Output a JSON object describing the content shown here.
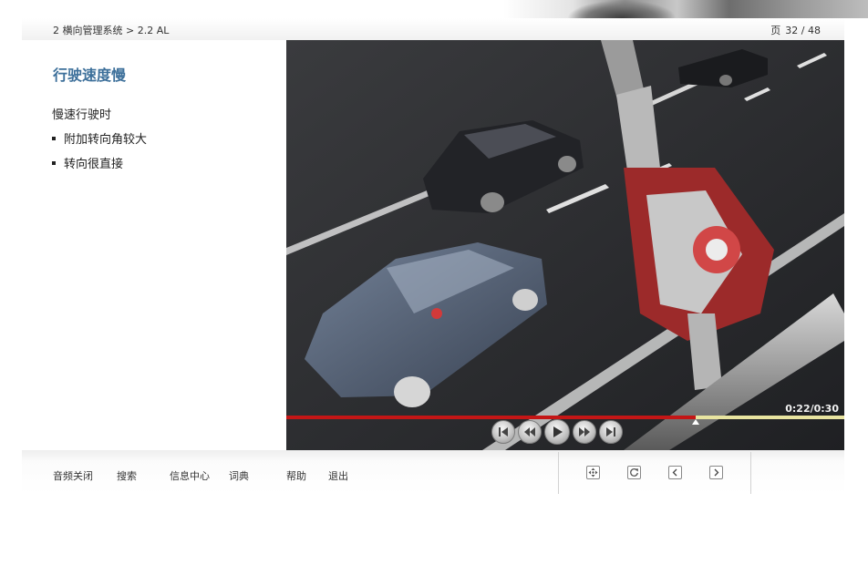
{
  "header": {
    "breadcrumb": "2 横向管理系统 > 2.2 AL",
    "page_label": "页",
    "page_counter": "32 / 48"
  },
  "content": {
    "title": "行驶速度慢",
    "subhead": "慢速行驶时",
    "bullets": [
      "附加转向角较大",
      "转向很直接"
    ]
  },
  "video": {
    "time": "0:22/0:30",
    "progress_fraction": 0.733,
    "colors": {
      "played": "#c41616",
      "remaining": "#e8e4a0"
    },
    "controls": [
      {
        "name": "skip-start-icon"
      },
      {
        "name": "rewind-icon"
      },
      {
        "name": "play-icon"
      },
      {
        "name": "fast-forward-icon"
      },
      {
        "name": "skip-end-icon"
      }
    ]
  },
  "toolbar": {
    "links": [
      "音频关闭",
      "搜索",
      "信息中心",
      "词典",
      "帮助",
      "退出"
    ],
    "nav_icons": [
      "move-icon",
      "refresh-icon",
      "previous-icon",
      "next-icon"
    ]
  },
  "theme": {
    "title_color": "#3c6f9a"
  }
}
